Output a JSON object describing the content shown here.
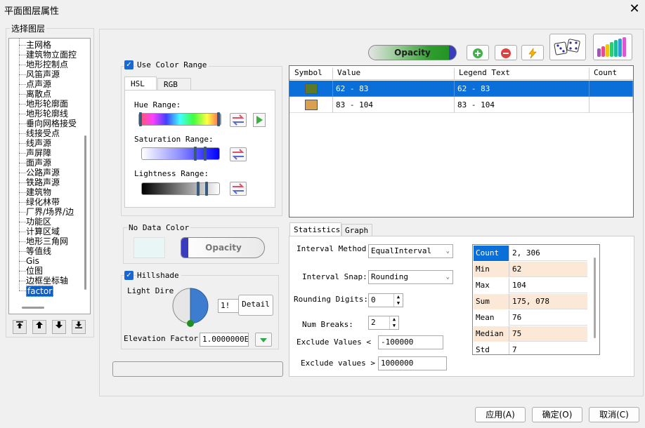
{
  "window": {
    "title": "平面图层属性",
    "close_symbol": "✕"
  },
  "layers": {
    "group_label": "选择图层",
    "items": [
      "主网格",
      "建筑物立面控",
      "地形控制点",
      "风笛声源",
      "点声源",
      "离散点",
      "地形轮廓面",
      "地形轮廓线",
      "垂向网格接受",
      "线接受点",
      "线声源",
      "声屏障",
      "面声源",
      "公路声源",
      "铁路声源",
      "建筑物",
      "绿化林带",
      "厂界/场界/边",
      "功能区",
      "计算区域",
      "地形三角网",
      "等值线",
      "Gis",
      "位图",
      "边框坐标轴",
      "factor"
    ],
    "selected": "factor",
    "move_buttons": [
      "move-top",
      "move-up",
      "move-down",
      "move-bottom"
    ]
  },
  "toolbar": {
    "opacity_label": "Opacity",
    "add_icon": "plus-circle-icon",
    "remove_icon": "minus-circle-icon",
    "lightning_icon": "lightning-icon",
    "dice_icon": "dice-icon",
    "palette_icon": "color-bars-icon"
  },
  "color_range": {
    "checkbox_label": "Use Color Range",
    "checked": true,
    "tabs": [
      "HSL",
      "RGB"
    ],
    "active_tab": "HSL",
    "hue_label": "Hue Range:",
    "saturation_label": "Saturation Range:",
    "lightness_label": "Lightness Range:"
  },
  "no_data": {
    "label": "No Data Color",
    "swatch_color": "#e8f6f6",
    "opacity_label": "Opacity"
  },
  "hillshade": {
    "label": "Hillshade",
    "checked": true,
    "light_dir_label": "Light Dire",
    "angle_value": "1!",
    "detail_label": "Detail",
    "elevation_label": "Elevation Factor",
    "elevation_value": "1.0000000E+"
  },
  "table": {
    "columns": [
      "Symbol",
      "Value",
      "Legend Text",
      "Count"
    ],
    "rows": [
      {
        "value": "62 - 83",
        "legend": "62 - 83",
        "count": "",
        "color": "#5a7a2a",
        "selected": true
      },
      {
        "value": "83 - 104",
        "legend": "83 - 104",
        "count": "",
        "color": "#d8a050",
        "selected": false
      }
    ]
  },
  "stats_tabs": [
    "Statistics",
    "Graph"
  ],
  "statistics": {
    "interval_method_label": "Interval Method:",
    "interval_method_value": "EqualInterval",
    "interval_snap_label": "Interval Snap:",
    "interval_snap_value": "Rounding",
    "rounding_digits_label": "Rounding Digits:",
    "rounding_digits_value": "0",
    "num_breaks_label": "Num Breaks:",
    "num_breaks_value": "2",
    "exclude_values_label": "Exclude Values <",
    "exclude_values_value": "-100000",
    "exclude_values2_label": "Exclude values >",
    "exclude_values2_value": "1000000",
    "summary": [
      {
        "label": "Count",
        "value": "2, 306"
      },
      {
        "label": "Min",
        "value": "62"
      },
      {
        "label": "Max",
        "value": "104"
      },
      {
        "label": "Sum",
        "value": "175, 078"
      },
      {
        "label": "Mean",
        "value": "76"
      },
      {
        "label": "Median",
        "value": "75"
      },
      {
        "label": "Std",
        "value": "7"
      }
    ]
  },
  "footer": {
    "apply": "应用(A)",
    "ok": "确定(O)",
    "cancel": "取消(C)"
  }
}
